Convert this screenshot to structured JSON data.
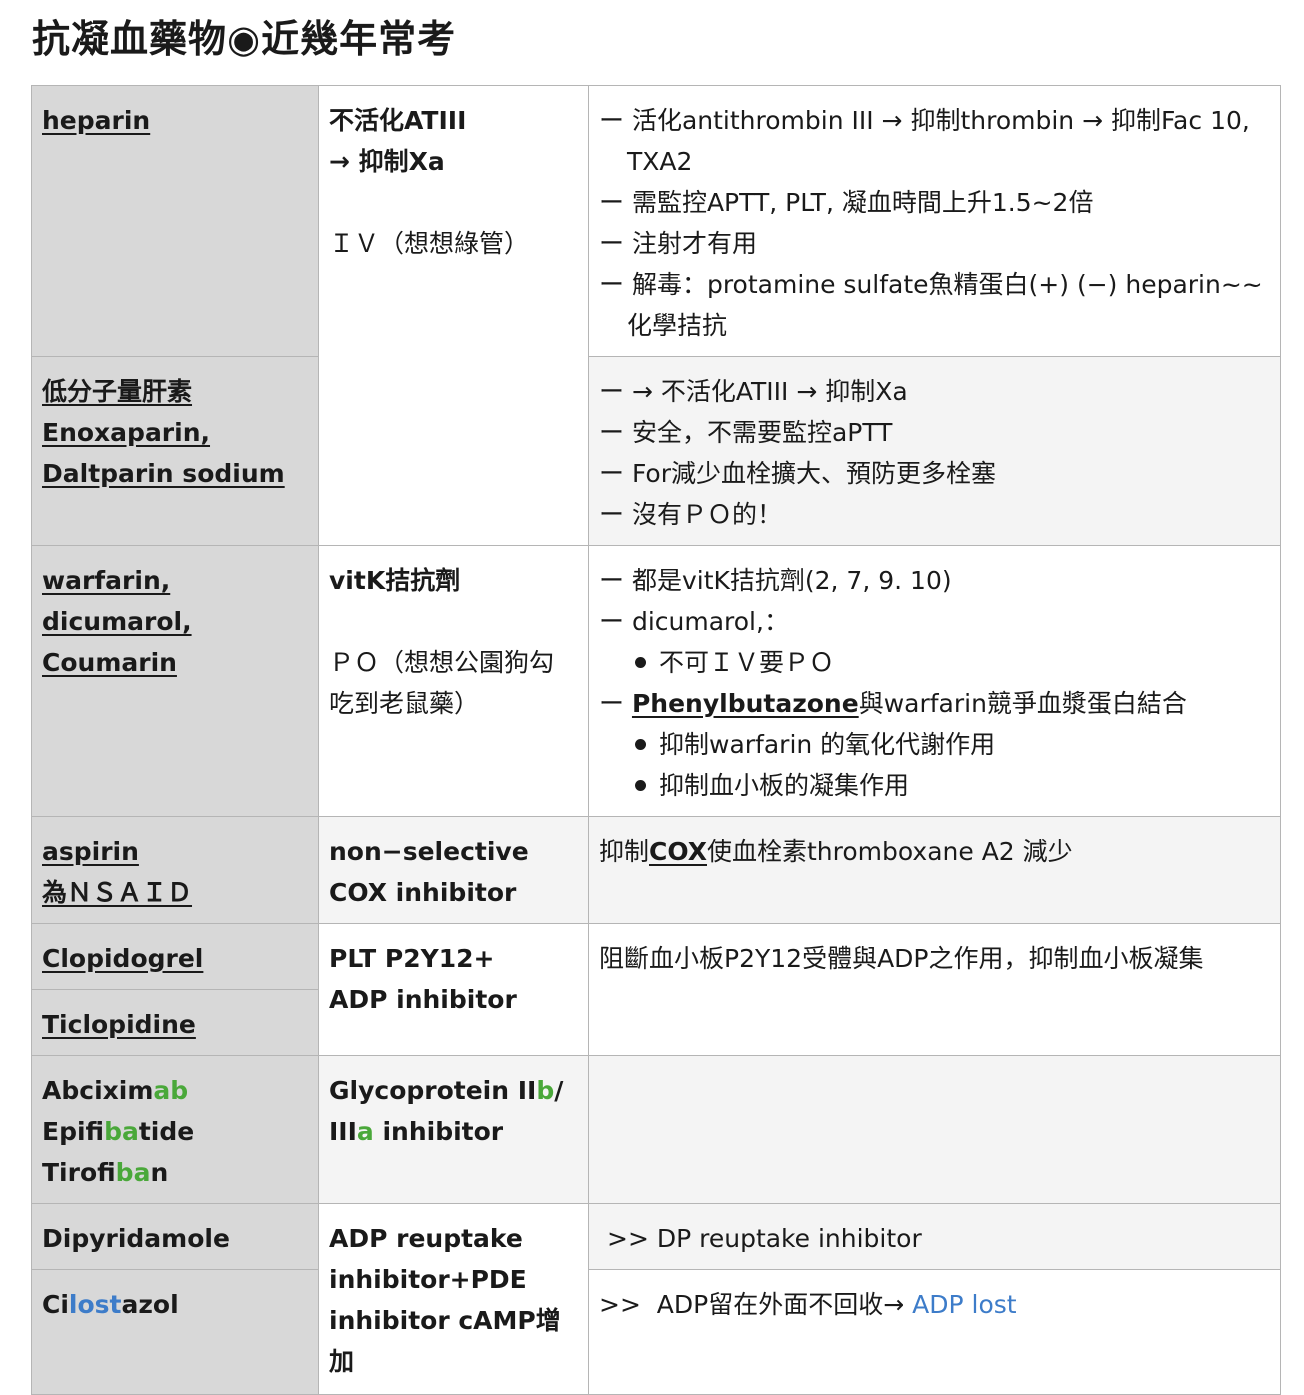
{
  "title": "抗凝血藥物◉近幾年常考",
  "rows": {
    "heparin": {
      "drug": "heparin",
      "mech1": "不活化ATIII",
      "mech2": "→ 抑制Xa",
      "route": "ＩＶ（想想綠管）",
      "notes": [
        "ー 活化antithrombin III → 抑制thrombin → 抑制Fac 10, TXA2",
        "ー 需監控APTT, PLT, 凝血時間上升1.5~2倍",
        "ー 注射才有用",
        "ー 解毒：protamine sulfate魚精蛋白(+) (−) heparin~~化學拮抗"
      ]
    },
    "lmwh": {
      "drug1": "低分子量肝素",
      "drug2": "Enoxaparin,",
      "drug3": "Daltparin sodium",
      "notes": [
        "ー → 不活化ATIII → 抑制Xa",
        "ー 安全，不需要監控aPTT",
        "ー For減少血栓擴大、預防更多栓塞",
        "ー 沒有ＰＯ的！"
      ]
    },
    "warfarin": {
      "drug1": "warfarin,",
      "drug2": "dicumarol,",
      "drug3": "Coumarin",
      "mech": "vitK拮抗劑",
      "route": "ＰＯ（想想公園狗勾吃到老鼠藥）",
      "note1": "ー 都是vitK拮抗劑(2, 7, 9. 10)",
      "note2": "ー dicumarol,：",
      "bullet1": "不可ＩＶ要ＰＯ",
      "note3_prefix": "ー ",
      "note3_link": "Phenylbutazone",
      "note3_rest": "與warfarin競爭血漿蛋白結合",
      "bullet2": "抑制warfarin 的氧化代謝作用",
      "bullet3": "抑制血小板的凝集作用"
    },
    "aspirin": {
      "drug1": "aspirin",
      "drug2": "為ＮＳＡＩＤ",
      "mech1": "non−selective",
      "mech2": "COX inhibitor",
      "note_prefix": "抑制",
      "note_link": "COX",
      "note_rest": "使血栓素thromboxane A2 減少"
    },
    "p2y12": {
      "drug1": "Clopidogrel",
      "drug2": "Ticlopidine",
      "mech1": "PLT P2Y12+",
      "mech2": "ADP inhibitor",
      "note": "阻斷血小板P2Y12受體與ADP之作用，抑制血小板凝集"
    },
    "gp": {
      "drug1_a": "Abcixim",
      "drug1_b": "ab",
      "drug2_a": "Epifi",
      "drug2_b": "ba",
      "drug2_c": "tide",
      "drug3_a": "Tirofi",
      "drug3_b": "ba",
      "drug3_c": "n",
      "mech_a": "Glycoprotein II",
      "mech_b": "b",
      "mech_c": "/",
      "mech_d": "III",
      "mech_e": "a",
      "mech_f": " inhibitor"
    },
    "adp": {
      "drug1": "Dipyridamole",
      "drug2_a": "Ci",
      "drug2_b": "lost",
      "drug2_c": "azol",
      "mech": "ADP reuptake inhibitor+PDE inhibitor cAMP增加",
      "note1": ">> DP reuptake inhibitor",
      "note2_a": ">>  ADP留在外面不回收→ ",
      "note2_b": "ADP lost"
    }
  },
  "colors": {
    "drug_bg": "#d8d8d8",
    "accent_green": "#4aa83a",
    "accent_blue": "#3d7cc9",
    "border": "#b5b5b5"
  }
}
